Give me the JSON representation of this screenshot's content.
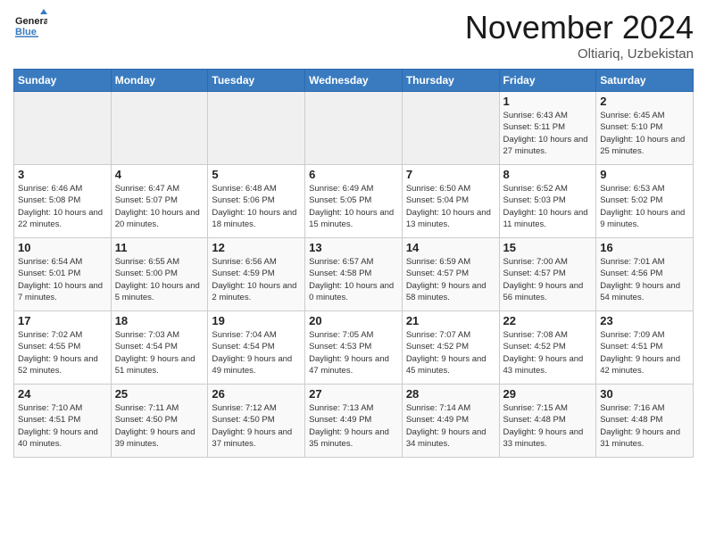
{
  "header": {
    "logo_general": "General",
    "logo_blue": "Blue",
    "month": "November 2024",
    "location": "Oltiariq, Uzbekistan"
  },
  "weekdays": [
    "Sunday",
    "Monday",
    "Tuesday",
    "Wednesday",
    "Thursday",
    "Friday",
    "Saturday"
  ],
  "weeks": [
    [
      {
        "day": "",
        "empty": true
      },
      {
        "day": "",
        "empty": true
      },
      {
        "day": "",
        "empty": true
      },
      {
        "day": "",
        "empty": true
      },
      {
        "day": "",
        "empty": true
      },
      {
        "day": "1",
        "sunrise": "6:43 AM",
        "sunset": "5:11 PM",
        "daylight": "10 hours and 27 minutes."
      },
      {
        "day": "2",
        "sunrise": "6:45 AM",
        "sunset": "5:10 PM",
        "daylight": "10 hours and 25 minutes."
      }
    ],
    [
      {
        "day": "3",
        "sunrise": "6:46 AM",
        "sunset": "5:08 PM",
        "daylight": "10 hours and 22 minutes."
      },
      {
        "day": "4",
        "sunrise": "6:47 AM",
        "sunset": "5:07 PM",
        "daylight": "10 hours and 20 minutes."
      },
      {
        "day": "5",
        "sunrise": "6:48 AM",
        "sunset": "5:06 PM",
        "daylight": "10 hours and 18 minutes."
      },
      {
        "day": "6",
        "sunrise": "6:49 AM",
        "sunset": "5:05 PM",
        "daylight": "10 hours and 15 minutes."
      },
      {
        "day": "7",
        "sunrise": "6:50 AM",
        "sunset": "5:04 PM",
        "daylight": "10 hours and 13 minutes."
      },
      {
        "day": "8",
        "sunrise": "6:52 AM",
        "sunset": "5:03 PM",
        "daylight": "10 hours and 11 minutes."
      },
      {
        "day": "9",
        "sunrise": "6:53 AM",
        "sunset": "5:02 PM",
        "daylight": "10 hours and 9 minutes."
      }
    ],
    [
      {
        "day": "10",
        "sunrise": "6:54 AM",
        "sunset": "5:01 PM",
        "daylight": "10 hours and 7 minutes."
      },
      {
        "day": "11",
        "sunrise": "6:55 AM",
        "sunset": "5:00 PM",
        "daylight": "10 hours and 5 minutes."
      },
      {
        "day": "12",
        "sunrise": "6:56 AM",
        "sunset": "4:59 PM",
        "daylight": "10 hours and 2 minutes."
      },
      {
        "day": "13",
        "sunrise": "6:57 AM",
        "sunset": "4:58 PM",
        "daylight": "10 hours and 0 minutes."
      },
      {
        "day": "14",
        "sunrise": "6:59 AM",
        "sunset": "4:57 PM",
        "daylight": "9 hours and 58 minutes."
      },
      {
        "day": "15",
        "sunrise": "7:00 AM",
        "sunset": "4:57 PM",
        "daylight": "9 hours and 56 minutes."
      },
      {
        "day": "16",
        "sunrise": "7:01 AM",
        "sunset": "4:56 PM",
        "daylight": "9 hours and 54 minutes."
      }
    ],
    [
      {
        "day": "17",
        "sunrise": "7:02 AM",
        "sunset": "4:55 PM",
        "daylight": "9 hours and 52 minutes."
      },
      {
        "day": "18",
        "sunrise": "7:03 AM",
        "sunset": "4:54 PM",
        "daylight": "9 hours and 51 minutes."
      },
      {
        "day": "19",
        "sunrise": "7:04 AM",
        "sunset": "4:54 PM",
        "daylight": "9 hours and 49 minutes."
      },
      {
        "day": "20",
        "sunrise": "7:05 AM",
        "sunset": "4:53 PM",
        "daylight": "9 hours and 47 minutes."
      },
      {
        "day": "21",
        "sunrise": "7:07 AM",
        "sunset": "4:52 PM",
        "daylight": "9 hours and 45 minutes."
      },
      {
        "day": "22",
        "sunrise": "7:08 AM",
        "sunset": "4:52 PM",
        "daylight": "9 hours and 43 minutes."
      },
      {
        "day": "23",
        "sunrise": "7:09 AM",
        "sunset": "4:51 PM",
        "daylight": "9 hours and 42 minutes."
      }
    ],
    [
      {
        "day": "24",
        "sunrise": "7:10 AM",
        "sunset": "4:51 PM",
        "daylight": "9 hours and 40 minutes."
      },
      {
        "day": "25",
        "sunrise": "7:11 AM",
        "sunset": "4:50 PM",
        "daylight": "9 hours and 39 minutes."
      },
      {
        "day": "26",
        "sunrise": "7:12 AM",
        "sunset": "4:50 PM",
        "daylight": "9 hours and 37 minutes."
      },
      {
        "day": "27",
        "sunrise": "7:13 AM",
        "sunset": "4:49 PM",
        "daylight": "9 hours and 35 minutes."
      },
      {
        "day": "28",
        "sunrise": "7:14 AM",
        "sunset": "4:49 PM",
        "daylight": "9 hours and 34 minutes."
      },
      {
        "day": "29",
        "sunrise": "7:15 AM",
        "sunset": "4:48 PM",
        "daylight": "9 hours and 33 minutes."
      },
      {
        "day": "30",
        "sunrise": "7:16 AM",
        "sunset": "4:48 PM",
        "daylight": "9 hours and 31 minutes."
      }
    ]
  ]
}
